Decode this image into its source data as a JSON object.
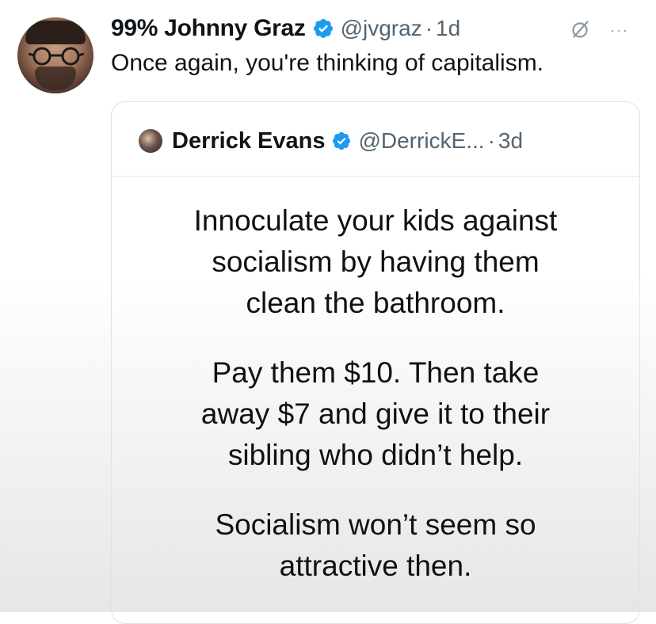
{
  "post": {
    "author": {
      "display_name": "99% Johnny Graz",
      "handle": "@jvgraz",
      "time": "1d",
      "separator": "·",
      "verified": true
    },
    "more_label": "···",
    "text": "Once again, you're thinking of capitalism.",
    "icons": {
      "verified": "verified-badge-icon",
      "grok": "grok-icon",
      "more": "more-options-icon"
    },
    "colors": {
      "verified_blue": "#1d9bf0",
      "secondary_text": "#536471",
      "primary_text": "#0f1419"
    }
  },
  "quote": {
    "author": {
      "display_name": "Derrick Evans",
      "handle": "@DerrickE...",
      "time": "3d",
      "separator": "·",
      "verified": true
    },
    "paragraphs": [
      "Innoculate your kids against\nsocialism by having them\nclean the bathroom.",
      "Pay them $10. Then take\naway $7 and give it to their\nsibling who didn’t help.",
      "Socialism won’t seem so\nattractive then."
    ]
  }
}
